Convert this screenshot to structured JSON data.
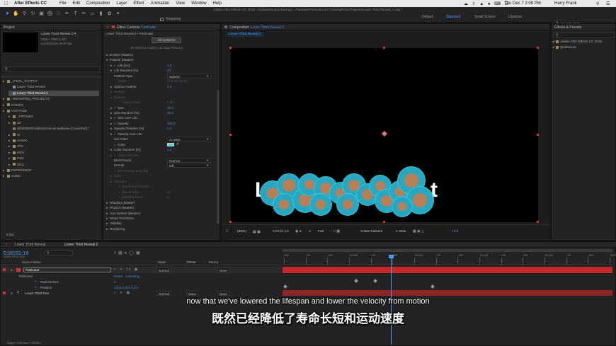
{
  "menubar": {
    "app": "After Effects CC",
    "items": [
      "File",
      "Edit",
      "Composition",
      "Layer",
      "Effect",
      "Animation",
      "View",
      "Window",
      "Help"
    ],
    "datetime": "Thu Dec 7  2:08 PM",
    "user": "Harry Frank"
  },
  "window_title": "Adobe After Effects CC 2018 - /Volumes/Local Backup/.../Tutorials/Particular 3.0 Training/Final Projects/Lower Third Reveal_1.aep *",
  "toolbar": {
    "snapping": "Snapping",
    "workspaces": [
      "Default",
      "Standard",
      "Small Screen",
      "Libraries"
    ],
    "active_workspace": "Standard",
    "search_help": "Search Help"
  },
  "project": {
    "tab": "Project",
    "comp_name": "Lower Third Reveal 2 ▾",
    "comp_size": "1920 x 1080 (1.00)",
    "comp_duration": "Δ 0;00;05;00, 29.97 fps",
    "items": [
      {
        "label": "_FINAL_OUTPUT",
        "type": "folder",
        "indent": 0
      },
      {
        "label": "Lower Third Reveal",
        "type": "comp",
        "indent": 1
      },
      {
        "label": "Lower Third Reveal 2",
        "type": "comp",
        "indent": 1,
        "selected": true
      },
      {
        "label": "+IMPORTED_PROJECTS",
        "type": "folder",
        "indent": 0
      },
      {
        "label": "COMPS",
        "type": "folder",
        "indent": 0
      },
      {
        "label": "FOOTAGE",
        "type": "folder",
        "indent": 0
      },
      {
        "label": "_PROXIES",
        "type": "folder",
        "indent": 1
      },
      {
        "label": "3D",
        "type": "folder",
        "indent": 1
      },
      {
        "label": "000088970-editorial-hot-air-balloons (Converted).r",
        "type": "file",
        "indent": 1
      },
      {
        "label": "AI",
        "type": "folder",
        "indent": 1
      },
      {
        "label": "AUDIO",
        "type": "folder",
        "indent": 1
      },
      {
        "label": "JPG",
        "type": "folder",
        "indent": 1
      },
      {
        "label": "MOV",
        "type": "folder",
        "indent": 1
      },
      {
        "label": "PSD",
        "type": "folder",
        "indent": 1
      },
      {
        "label": "SEQ",
        "type": "folder",
        "indent": 1
      },
      {
        "label": "REFERENCE",
        "type": "folder",
        "indent": 0
      },
      {
        "label": "Solids",
        "type": "folder",
        "indent": 0
      }
    ],
    "bpc": "8 bpc"
  },
  "effect_controls": {
    "tab_prefix": "Effect Controls",
    "tab_layer": "Particular",
    "subtitle": "Lower Third Reveal 2 • Particular",
    "systems_button": "All Systems",
    "particle_counts": "46 Particles Visible | 62 Total Particles",
    "rows": [
      {
        "label": "Emitter (Master)",
        "indent": 1,
        "value": "",
        "arrow": true
      },
      {
        "label": "Particle (Master)",
        "indent": 1,
        "value": "",
        "arrow": true,
        "open": true
      },
      {
        "label": "Life [sec]",
        "indent": 2,
        "value": "1.5",
        "sw": true,
        "arrow": true
      },
      {
        "label": "Life Random [%]",
        "indent": 2,
        "value": "25",
        "arrow": true
      },
      {
        "label": "Particle Type",
        "indent": 2,
        "value": "Sphere",
        "dropdown": true
      },
      {
        "label": "Sprite",
        "indent": 3,
        "value": "Choose Sprite...",
        "dim": true
      },
      {
        "label": "Sphere Feather",
        "indent": 2,
        "value": "0.0",
        "arrow": true
      },
      {
        "label": "Texture",
        "indent": 2,
        "value": "",
        "dim": true,
        "arrow": true
      },
      {
        "label": "Rotation",
        "indent": 2,
        "value": "",
        "dim": true,
        "arrow": true
      },
      {
        "label": "Aspect Ratio",
        "indent": 3,
        "value": "1.00",
        "dim": true,
        "sw": true
      },
      {
        "label": "Size",
        "indent": 2,
        "value": "75.0",
        "sw": true,
        "arrow": true
      },
      {
        "label": "Size Random [%]",
        "indent": 2,
        "value": "25.0",
        "arrow": true
      },
      {
        "label": "Size over Life",
        "indent": 2,
        "value": "",
        "arrow": true,
        "sw": true
      },
      {
        "label": "Opacity",
        "indent": 2,
        "value": "100.0",
        "sw": true,
        "arrow": true
      },
      {
        "label": "Opacity Random [%]",
        "indent": 2,
        "value": "0.0",
        "arrow": true
      },
      {
        "label": "Opacity over Life",
        "indent": 2,
        "value": "",
        "arrow": true,
        "sw": true
      },
      {
        "label": "Set Color",
        "indent": 2,
        "value": "At Start",
        "dropdown": true
      },
      {
        "label": "Color",
        "indent": 2,
        "value": "",
        "swatch": true,
        "sw": true
      },
      {
        "label": "Color Random [%]",
        "indent": 2,
        "value": "0.0",
        "arrow": true
      },
      {
        "label": "Color over Life",
        "indent": 2,
        "value": "",
        "dim": true,
        "arrow": true,
        "sw": true
      },
      {
        "label": "Blend Mode",
        "indent": 2,
        "value": "Normal",
        "dropdown": true
      },
      {
        "label": "Unmult",
        "indent": 2,
        "value": "Off",
        "dropdown": true
      },
      {
        "label": "Blend Mode over Life",
        "indent": 2,
        "value": "",
        "dim": true,
        "sw": true
      },
      {
        "label": "Glow",
        "indent": 2,
        "value": "",
        "dim": true,
        "arrow": true
      },
      {
        "label": "Streaklet",
        "indent": 2,
        "value": "",
        "dim": true,
        "arrow": true
      },
      {
        "label": "Number of Streaks",
        "indent": 3,
        "value": "",
        "dim": true,
        "sw": true
      },
      {
        "label": "Streak Size",
        "indent": 3,
        "value": "40",
        "dim": true,
        "sw": true
      },
      {
        "label": "Random Seed",
        "indent": 3,
        "value": "0",
        "dim": true,
        "sw": true
      },
      {
        "label": "Shading (Master)",
        "indent": 1,
        "value": "",
        "arrow": true
      },
      {
        "label": "Physics (Master)",
        "indent": 1,
        "value": "",
        "arrow": true
      },
      {
        "label": "Aux System (Master)",
        "indent": 1,
        "value": "",
        "arrow": true
      },
      {
        "label": "World Transform",
        "indent": 1,
        "value": "",
        "arrow": true
      },
      {
        "label": "Visibility",
        "indent": 1,
        "value": "",
        "arrow": true
      },
      {
        "label": "Rendering",
        "indent": 1,
        "value": "",
        "arrow": true
      }
    ],
    "swatch_color": "#4fd3e8"
  },
  "composition": {
    "tab_prefix": "Composition",
    "tab_comp": "Lower Third Reveal 2",
    "breadcrumb": "Lower Third Reveal 2",
    "footer": {
      "zoom": "(50%)",
      "timecode": "0;00;01;19",
      "resolution": "Full",
      "camera": "Active Camera",
      "view": "1 View",
      "exposure": "+0.0"
    },
    "text_left": "L",
    "text_right": "t"
  },
  "effects_presets": {
    "tab": "Effects & Presets",
    "items": [
      "Adobe After Effects CC 2018",
      "MediaCore"
    ]
  },
  "timeline": {
    "tabs": [
      "Lower Third Reveal",
      "Lower Third Reveal 2"
    ],
    "active_tab": 1,
    "timecode": "0;00;01;19",
    "timecode_sub": "00049 (29.97 fps)",
    "headers": {
      "source": "Source Name",
      "mode": "Mode",
      "trkmat": "TrkMat",
      "parent": "Parent"
    },
    "layers": [
      {
        "num": "1",
        "name": "Particular",
        "mode": "Normal",
        "trkmat": "",
        "parent": "None",
        "selected": true
      },
      {
        "num": "",
        "name": "Particular",
        "sub": true,
        "reset": "Reset",
        "licensing": "Licensing..."
      },
      {
        "num": "",
        "name": "Particles/sec",
        "prop": true,
        "value": "0"
      },
      {
        "num": "",
        "name": "Position",
        "prop": true,
        "value": "1304.0,924.0,0.0"
      },
      {
        "num": "3",
        "name": "Lower Third Text",
        "mode": "Normal",
        "trkmat": "None",
        "parent": "None",
        "text_layer": true
      }
    ],
    "ruler": [
      "00f",
      "10f",
      "20f",
      "01:00f",
      "10f",
      "20f",
      "02:00f",
      "10f",
      "20f",
      "03:00f",
      "10f",
      "20f",
      "04:00f",
      "10f",
      "20f",
      "05:0"
    ],
    "playhead_fraction": 0.328,
    "footer": "Toggle Switches / Modes"
  },
  "subtitles": {
    "en": "now that we've lowered the  lifespan and lower the velocity from motion",
    "zh": "既然已经降低了寿命长短和运动速度"
  }
}
